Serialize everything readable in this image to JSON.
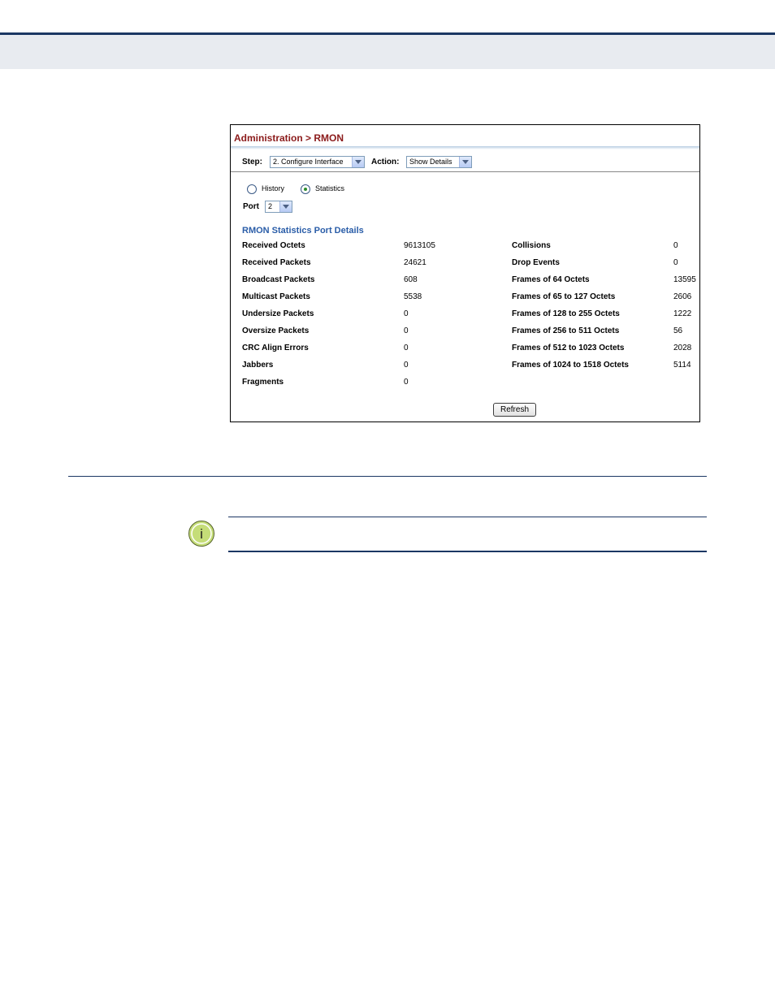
{
  "panel": {
    "breadcrumb": "Administration > RMON",
    "step_label": "Step:",
    "step_value": "2. Configure Interface",
    "action_label": "Action:",
    "action_value": "Show Details",
    "radio_history": "History",
    "radio_statistics": "Statistics",
    "selected_radio": "Statistics",
    "port_label": "Port",
    "port_value": "2",
    "section_title": "RMON Statistics Port Details",
    "left_stats": [
      {
        "name": "Received Octets",
        "value": "9613105"
      },
      {
        "name": "Received Packets",
        "value": "24621"
      },
      {
        "name": "Broadcast Packets",
        "value": "608"
      },
      {
        "name": "Multicast Packets",
        "value": "5538"
      },
      {
        "name": "Undersize Packets",
        "value": "0"
      },
      {
        "name": "Oversize Packets",
        "value": "0"
      },
      {
        "name": "CRC Align Errors",
        "value": "0"
      },
      {
        "name": "Jabbers",
        "value": "0"
      },
      {
        "name": "Fragments",
        "value": "0"
      }
    ],
    "right_stats": [
      {
        "name": "Collisions",
        "value": "0"
      },
      {
        "name": "Drop Events",
        "value": "0"
      },
      {
        "name": "Frames of 64 Octets",
        "value": "13595"
      },
      {
        "name": "Frames of 65 to 127 Octets",
        "value": "2606"
      },
      {
        "name": "Frames of 128 to 255 Octets",
        "value": "1222"
      },
      {
        "name": "Frames of 256 to 511 Octets",
        "value": "56"
      },
      {
        "name": "Frames of 512 to 1023 Octets",
        "value": "2028"
      },
      {
        "name": "Frames of 1024 to 1518 Octets",
        "value": "5114"
      }
    ],
    "refresh_label": "Refresh"
  },
  "note": {
    "icon": "info-icon",
    "icon_glyph": "i"
  }
}
